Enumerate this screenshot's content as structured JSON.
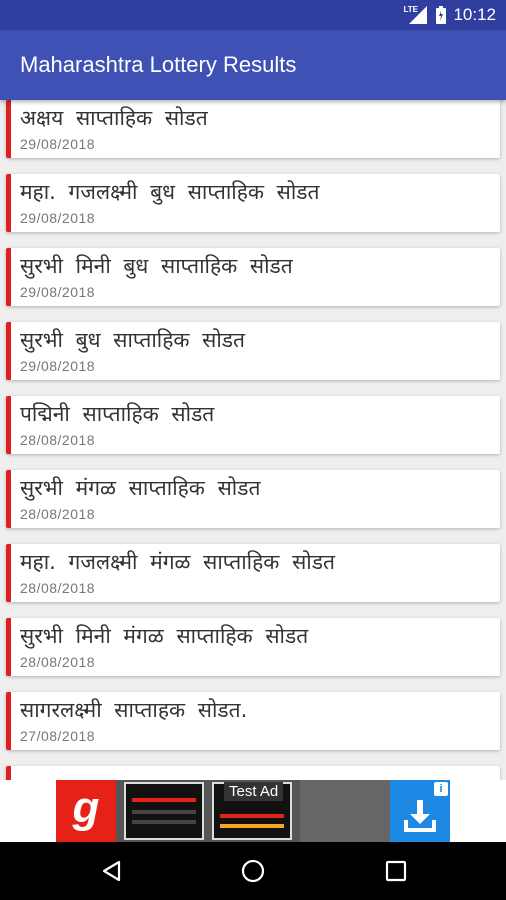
{
  "status_bar": {
    "network_label": "LTE",
    "time": "10:12",
    "icons": [
      "lte-signal-icon",
      "battery-icon"
    ]
  },
  "app_bar": {
    "title": "Maharashtra Lottery Results",
    "color": "#3f51b5"
  },
  "results": [
    {
      "title": "अक्षय साप्ताहिक सोडत",
      "date": "29/08/2018"
    },
    {
      "title": "महा. गजलक्ष्मी बुध साप्ताहिक सोडत",
      "date": "29/08/2018"
    },
    {
      "title": "सुरभी मिनी बुध साप्ताहिक सोडत",
      "date": "29/08/2018"
    },
    {
      "title": "सुरभी बुध साप्ताहिक सोडत",
      "date": "29/08/2018"
    },
    {
      "title": "पद्मिनी साप्ताहिक सोडत",
      "date": "28/08/2018"
    },
    {
      "title": "सुरभी मंगळ साप्ताहिक सोडत",
      "date": "28/08/2018"
    },
    {
      "title": "महा. गजलक्ष्मी मंगळ साप्ताहिक सोडत",
      "date": "28/08/2018"
    },
    {
      "title": "सुरभी मिनी मंगळ साप्ताहिक सोडत",
      "date": "28/08/2018"
    },
    {
      "title": "सागरलक्ष्मी साप्ताहक सोडत.",
      "date": "27/08/2018"
    }
  ],
  "accent_color": "#e02020",
  "ad": {
    "label": "Test Ad",
    "logo_text": "g",
    "info_icon": "i",
    "close_icon": "✕"
  },
  "nav_bar": {
    "icons": [
      "back-icon",
      "home-icon",
      "recents-icon"
    ]
  }
}
